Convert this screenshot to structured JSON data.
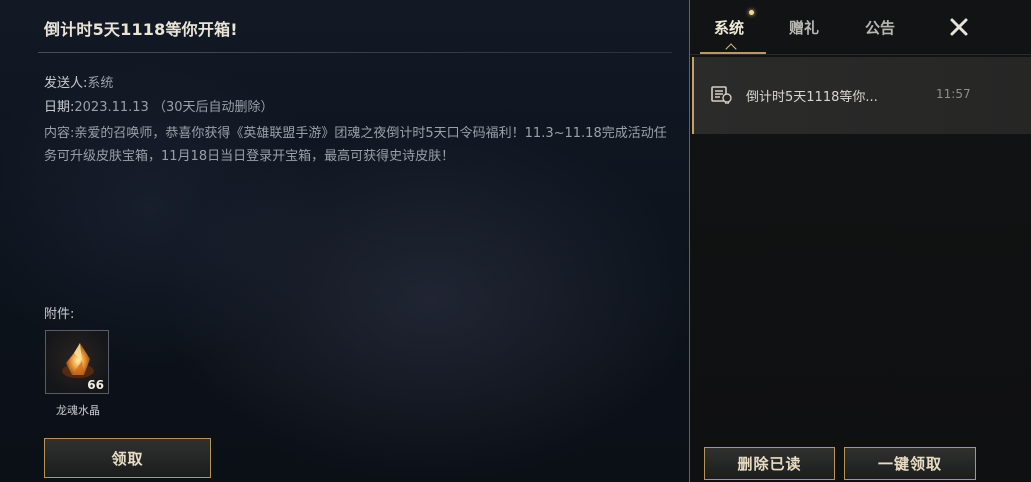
{
  "mail_detail": {
    "title": "倒计时5天1118等你开箱!",
    "sender_label": "发送人:",
    "sender_value": "系统",
    "date_label": "日期:",
    "date_value": "2023.11.13 （30天后自动删除）",
    "content_label": "内容:",
    "content_text": "亲爱的召唤师，恭喜你获得《英雄联盟手游》团魂之夜倒计时5天口令码福利！11.3~11.18完成活动任务可升级皮肤宝箱，11月18日当日登录开宝箱，最高可获得史诗皮肤！",
    "attachments_label": "附件:",
    "attachment": {
      "name": "龙魂水晶",
      "count": "66",
      "icon": "dragon-soul-crystal-icon"
    },
    "claim_button": "领取"
  },
  "mail_list": {
    "tabs": [
      {
        "label": "系统",
        "active": true,
        "has_new_dot": true
      },
      {
        "label": "赠礼",
        "active": false
      },
      {
        "label": "公告",
        "active": false
      }
    ],
    "close_icon": "close-icon",
    "items": [
      {
        "icon": "mail-scroll-icon",
        "subject": "倒计时5天1118等你...",
        "time": "11:57",
        "selected": true
      }
    ],
    "delete_read_button": "删除已读",
    "claim_all_button": "一键领取"
  },
  "colors": {
    "accent_gold": "#b99a5c",
    "text_primary": "#e9e4d6",
    "text_secondary": "#9aa0a8"
  }
}
